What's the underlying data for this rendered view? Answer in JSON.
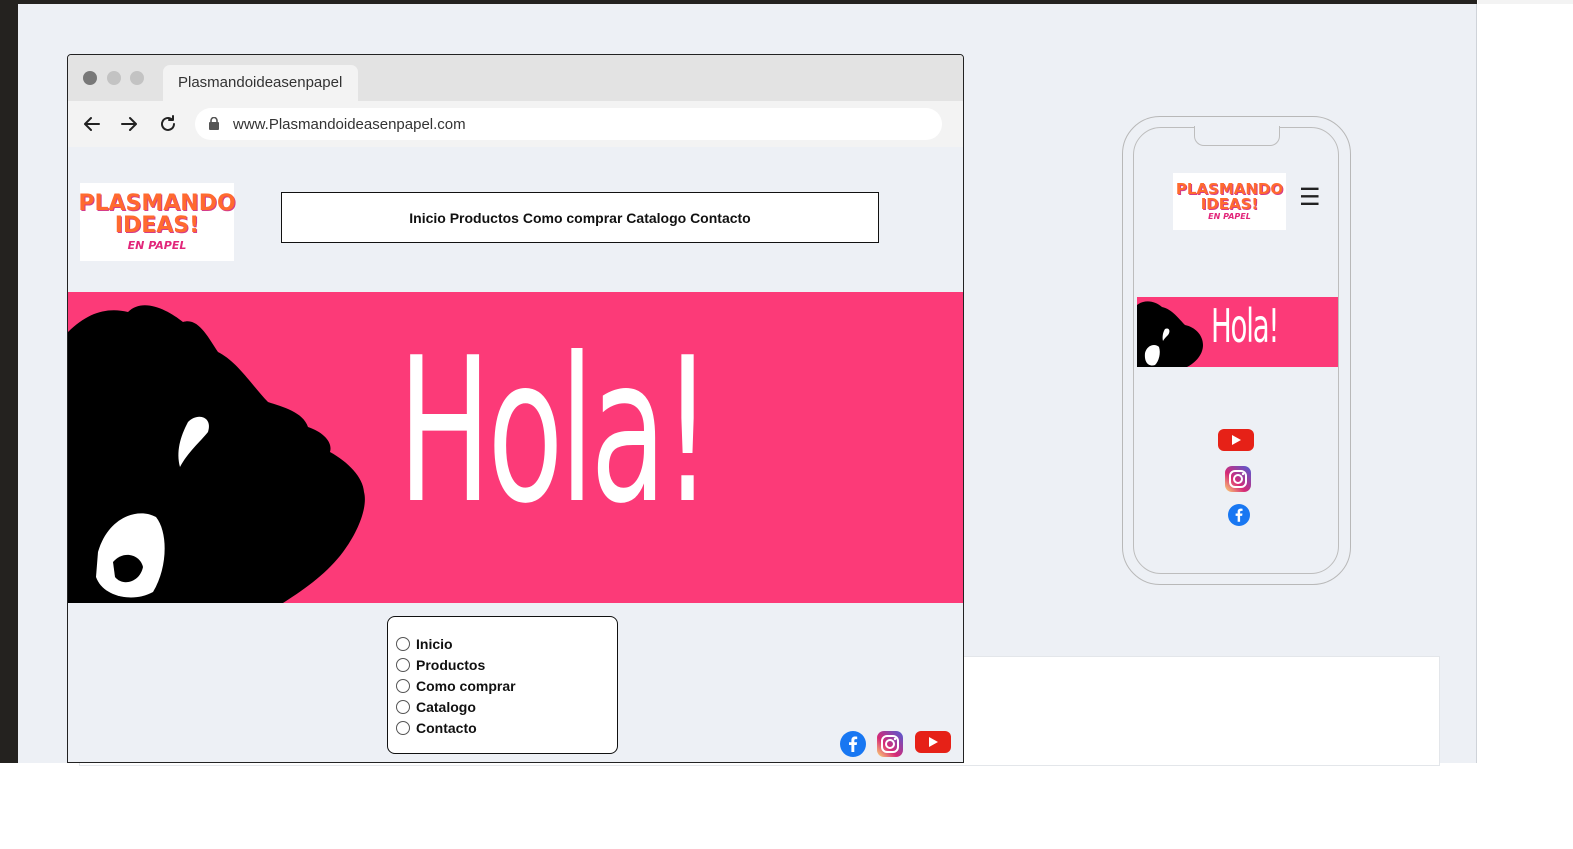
{
  "browser": {
    "tab_title": "Plasmandoideasenpapel",
    "url": "www.Plasmandoideasenpapel.com"
  },
  "logo": {
    "line1": "PLASMANDO",
    "line2": "IDEAS!",
    "line3": "EN PAPEL"
  },
  "nav": {
    "text": "Inicio Productos Como comprar Catalogo Contacto"
  },
  "hero": {
    "greeting": "Hola!"
  },
  "radio_menu": {
    "items": [
      "Inicio",
      "Productos",
      "Como comprar",
      "Catalogo",
      "Contacto"
    ]
  },
  "social_icons": [
    "facebook-icon",
    "instagram-icon",
    "youtube-icon"
  ],
  "colors": {
    "hero_pink": "#fc3a78",
    "logo_orange": "#ff6a2f",
    "canvas_bg": "#edf0f5"
  }
}
